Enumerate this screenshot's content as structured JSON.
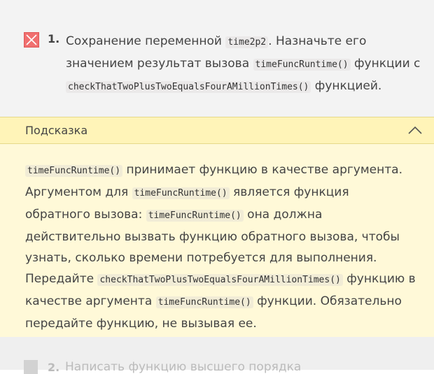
{
  "task": {
    "number": "1.",
    "status_icon": "x-mark-icon",
    "text_part1": "Сохранение переменной ",
    "code1": "time2p2",
    "text_part2": ". Назначьте его значением результат вызова ",
    "code2": "timeFuncRuntime()",
    "text_part3": " функции с ",
    "code3": "checkThatTwoPlusTwoEqualsFourAMillionTimes()",
    "text_part4": " функцией."
  },
  "hint": {
    "title": "Подсказка",
    "toggle_icon": "chevron-up-icon",
    "code1": "timeFuncRuntime()",
    "text1": " принимает функцию в качестве аргумента. Аргументом для ",
    "code2": "timeFuncRuntime()",
    "text2": " является функция обратного вызова: ",
    "code3": "timeFuncRuntime()",
    "text3": " она должна действительно вызвать функцию обратного вызова, чтобы узнать, сколько времени потребуется для выполнения. Передайте ",
    "code4": "checkThatTwoPlusTwoEqualsFourAMillionTimes()",
    "text4": " функцию в качестве аргумента ",
    "code5": "timeFuncRuntime()",
    "text5": " функции. Обязательно передайте функцию, не вызывая ее."
  },
  "next_task": {
    "number": "2.",
    "text": "Написать функцию высшего порядка"
  },
  "colors": {
    "error": "#f06f6f",
    "hint_header_bg": "#fff4b8",
    "hint_body_bg": "#fff9d8"
  }
}
